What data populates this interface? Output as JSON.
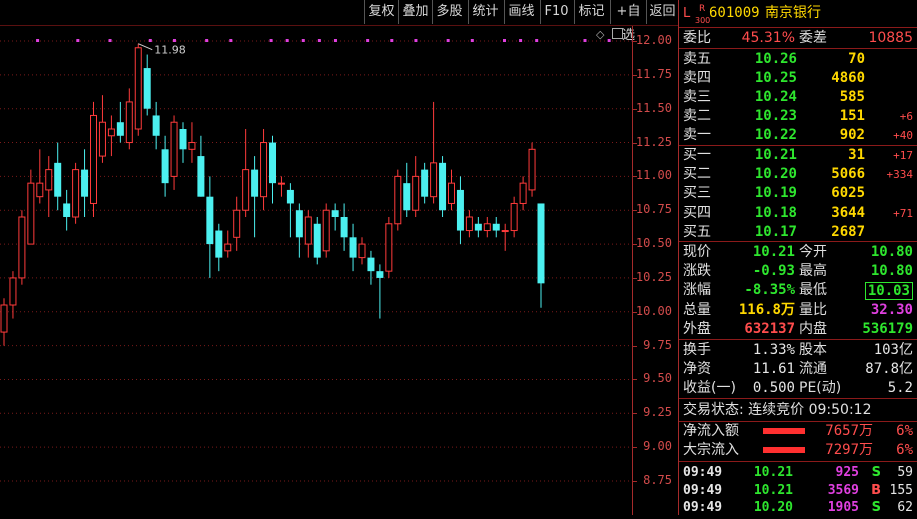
{
  "toolbar": {
    "buttons": [
      "复权",
      "叠加",
      "多股",
      "统计",
      "画线",
      "F10",
      "标记",
      "+自选",
      "返回"
    ]
  },
  "chart_data": {
    "type": "candlestick",
    "y_ticks": [
      "12.00",
      "11.75",
      "11.50",
      "11.25",
      "11.00",
      "10.75",
      "10.50",
      "10.25",
      "10.00",
      "9.75",
      "9.50",
      "9.25",
      "9.00",
      "8.75"
    ],
    "ylim": [
      8.55,
      12.18
    ],
    "annotation_high": "11.98",
    "candles": [
      {
        "o": 9.85,
        "c": 10.05,
        "h": 10.1,
        "l": 9.75
      },
      {
        "o": 10.05,
        "c": 10.25,
        "h": 10.3,
        "l": 9.95
      },
      {
        "o": 10.25,
        "c": 10.7,
        "h": 10.75,
        "l": 10.2
      },
      {
        "o": 10.5,
        "c": 10.95,
        "h": 11.05,
        "l": 10.5
      },
      {
        "o": 10.85,
        "c": 10.95,
        "h": 11.2,
        "l": 10.8
      },
      {
        "o": 10.9,
        "c": 11.05,
        "h": 11.15,
        "l": 10.7
      },
      {
        "o": 11.1,
        "c": 10.85,
        "h": 11.25,
        "l": 10.75
      },
      {
        "o": 10.8,
        "c": 10.7,
        "h": 10.9,
        "l": 10.6
      },
      {
        "o": 10.7,
        "c": 11.05,
        "h": 11.1,
        "l": 10.65
      },
      {
        "o": 11.05,
        "c": 10.85,
        "h": 11.2,
        "l": 10.7
      },
      {
        "o": 10.8,
        "c": 11.45,
        "h": 11.55,
        "l": 10.7
      },
      {
        "o": 11.15,
        "c": 11.4,
        "h": 11.6,
        "l": 11.1
      },
      {
        "o": 11.3,
        "c": 11.35,
        "h": 11.45,
        "l": 11.15
      },
      {
        "o": 11.4,
        "c": 11.3,
        "h": 11.55,
        "l": 11.25
      },
      {
        "o": 11.25,
        "c": 11.55,
        "h": 11.65,
        "l": 11.2
      },
      {
        "o": 11.35,
        "c": 11.95,
        "h": 11.98,
        "l": 11.3
      },
      {
        "o": 11.8,
        "c": 11.5,
        "h": 11.9,
        "l": 11.45
      },
      {
        "o": 11.45,
        "c": 11.3,
        "h": 11.55,
        "l": 11.2
      },
      {
        "o": 11.2,
        "c": 10.95,
        "h": 11.3,
        "l": 10.85
      },
      {
        "o": 11.0,
        "c": 11.4,
        "h": 11.45,
        "l": 10.9
      },
      {
        "o": 11.35,
        "c": 11.2,
        "h": 11.4,
        "l": 11.1
      },
      {
        "o": 11.2,
        "c": 11.25,
        "h": 11.4,
        "l": 11.1
      },
      {
        "o": 11.15,
        "c": 10.85,
        "h": 11.3,
        "l": 10.85
      },
      {
        "o": 10.85,
        "c": 10.5,
        "h": 11.0,
        "l": 10.25
      },
      {
        "o": 10.6,
        "c": 10.4,
        "h": 10.65,
        "l": 10.3
      },
      {
        "o": 10.45,
        "c": 10.5,
        "h": 10.6,
        "l": 10.4
      },
      {
        "o": 10.55,
        "c": 10.75,
        "h": 10.85,
        "l": 10.45
      },
      {
        "o": 10.75,
        "c": 11.05,
        "h": 11.35,
        "l": 10.7
      },
      {
        "o": 11.05,
        "c": 10.85,
        "h": 11.15,
        "l": 10.55
      },
      {
        "o": 10.85,
        "c": 11.25,
        "h": 11.35,
        "l": 10.75
      },
      {
        "o": 11.25,
        "c": 10.95,
        "h": 11.3,
        "l": 10.8
      },
      {
        "o": 10.95,
        "c": 10.95,
        "h": 11.0,
        "l": 10.85
      },
      {
        "o": 10.9,
        "c": 10.8,
        "h": 10.95,
        "l": 10.55
      },
      {
        "o": 10.75,
        "c": 10.55,
        "h": 10.8,
        "l": 10.4
      },
      {
        "o": 10.5,
        "c": 10.7,
        "h": 10.75,
        "l": 10.4
      },
      {
        "o": 10.65,
        "c": 10.4,
        "h": 10.7,
        "l": 10.35
      },
      {
        "o": 10.45,
        "c": 10.75,
        "h": 10.8,
        "l": 10.4
      },
      {
        "o": 10.75,
        "c": 10.7,
        "h": 10.8,
        "l": 10.6
      },
      {
        "o": 10.7,
        "c": 10.55,
        "h": 10.8,
        "l": 10.45
      },
      {
        "o": 10.55,
        "c": 10.4,
        "h": 10.65,
        "l": 10.3
      },
      {
        "o": 10.4,
        "c": 10.5,
        "h": 10.55,
        "l": 10.35
      },
      {
        "o": 10.4,
        "c": 10.3,
        "h": 10.45,
        "l": 10.2
      },
      {
        "o": 10.3,
        "c": 10.25,
        "h": 10.35,
        "l": 9.95
      },
      {
        "o": 10.3,
        "c": 10.65,
        "h": 10.7,
        "l": 10.25
      },
      {
        "o": 10.65,
        "c": 11.0,
        "h": 11.05,
        "l": 10.6
      },
      {
        "o": 10.95,
        "c": 10.75,
        "h": 11.1,
        "l": 10.7
      },
      {
        "o": 10.75,
        "c": 11.0,
        "h": 11.15,
        "l": 10.7
      },
      {
        "o": 11.05,
        "c": 10.85,
        "h": 11.1,
        "l": 10.8
      },
      {
        "o": 10.85,
        "c": 11.1,
        "h": 11.55,
        "l": 10.8
      },
      {
        "o": 11.1,
        "c": 10.75,
        "h": 11.15,
        "l": 10.7
      },
      {
        "o": 10.8,
        "c": 10.95,
        "h": 11.05,
        "l": 10.75
      },
      {
        "o": 10.9,
        "c": 10.6,
        "h": 11.0,
        "l": 10.5
      },
      {
        "o": 10.6,
        "c": 10.7,
        "h": 10.75,
        "l": 10.55
      },
      {
        "o": 10.65,
        "c": 10.6,
        "h": 10.7,
        "l": 10.55
      },
      {
        "o": 10.6,
        "c": 10.65,
        "h": 10.7,
        "l": 10.55
      },
      {
        "o": 10.65,
        "c": 10.6,
        "h": 10.7,
        "l": 10.55
      },
      {
        "o": 10.6,
        "c": 10.6,
        "h": 10.65,
        "l": 10.45
      },
      {
        "o": 10.6,
        "c": 10.8,
        "h": 10.85,
        "l": 10.55
      },
      {
        "o": 10.8,
        "c": 10.95,
        "h": 11.0,
        "l": 10.75
      },
      {
        "o": 10.9,
        "c": 11.2,
        "h": 11.25,
        "l": 10.85
      },
      {
        "o": 10.8,
        "c": 10.21,
        "h": 10.8,
        "l": 10.03
      }
    ],
    "dots_y": 12.0
  },
  "quote": {
    "prefix": "L",
    "badge_r": "R",
    "badge_300": "300",
    "code": "601009",
    "name": "南京银行",
    "weibi_label": "委比",
    "weibi": "45.31%",
    "weicha_label": "委差",
    "weicha": "10885",
    "asks": [
      {
        "label": "卖五",
        "price": "10.26",
        "vol": "70",
        "chg": ""
      },
      {
        "label": "卖四",
        "price": "10.25",
        "vol": "4860",
        "chg": ""
      },
      {
        "label": "卖三",
        "price": "10.24",
        "vol": "585",
        "chg": ""
      },
      {
        "label": "卖二",
        "price": "10.23",
        "vol": "151",
        "chg": "+6"
      },
      {
        "label": "卖一",
        "price": "10.22",
        "vol": "902",
        "chg": "+40"
      }
    ],
    "bids": [
      {
        "label": "买一",
        "price": "10.21",
        "vol": "31",
        "chg": "+17"
      },
      {
        "label": "买二",
        "price": "10.20",
        "vol": "5066",
        "chg": "+334"
      },
      {
        "label": "买三",
        "price": "10.19",
        "vol": "6025",
        "chg": ""
      },
      {
        "label": "买四",
        "price": "10.18",
        "vol": "3644",
        "chg": "+71"
      },
      {
        "label": "买五",
        "price": "10.17",
        "vol": "2687",
        "chg": ""
      }
    ],
    "stats": [
      {
        "l1": "现价",
        "v1": "10.21",
        "c1": "green",
        "l2": "今开",
        "v2": "10.80",
        "c2": "green"
      },
      {
        "l1": "涨跌",
        "v1": "-0.93",
        "c1": "green",
        "l2": "最高",
        "v2": "10.80",
        "c2": "green"
      },
      {
        "l1": "涨幅",
        "v1": "-8.35%",
        "c1": "green",
        "l2": "最低",
        "v2": "10.03",
        "c2": "green"
      },
      {
        "l1": "总量",
        "v1": "116.8万",
        "c1": "yellow",
        "l2": "量比",
        "v2": "32.30",
        "c2": "magenta"
      },
      {
        "l1": "外盘",
        "v1": "632137",
        "c1": "red",
        "l2": "内盘",
        "v2": "536179",
        "c2": "green"
      }
    ],
    "fundamentals": [
      {
        "l1": "换手",
        "v1": "1.33%",
        "l2": "股本",
        "v2": "103亿"
      },
      {
        "l1": "净资",
        "v1": "11.61",
        "l2": "流通",
        "v2": "87.8亿"
      },
      {
        "l1": "收益(一)",
        "v1": "0.500",
        "l2": "PE(动)",
        "v2": "5.2"
      }
    ],
    "trade_status": "交易状态: 连续竞价 09:50:12",
    "flows": [
      {
        "label": "净流入额",
        "value": "7657万",
        "pct": "6%",
        "bar": 0.8
      },
      {
        "label": "大宗流入",
        "value": "7297万",
        "pct": "6%",
        "bar": 0.8
      }
    ],
    "ticks": [
      {
        "time": "09:49",
        "price": "10.21",
        "vol": "925",
        "side": "S",
        "n": "59",
        "vc": "magenta",
        "sc": "green"
      },
      {
        "time": "09:49",
        "price": "10.21",
        "vol": "3569",
        "side": "B",
        "n": "155",
        "vc": "magenta",
        "sc": "red"
      },
      {
        "time": "09:49",
        "price": "10.20",
        "vol": "1905",
        "side": "S",
        "n": "62",
        "vc": "magenta",
        "sc": "green"
      }
    ]
  }
}
